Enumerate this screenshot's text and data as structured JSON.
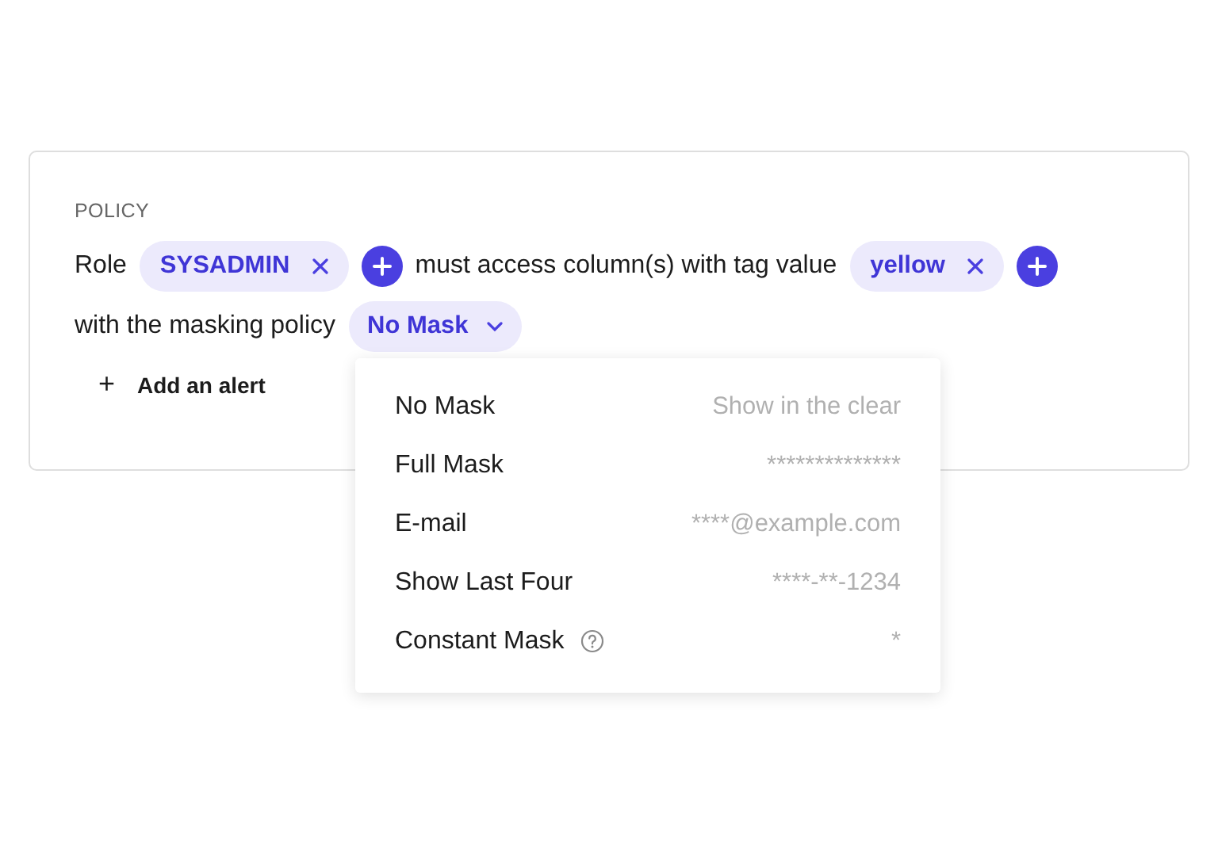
{
  "policy": {
    "heading": "POLICY",
    "lines": [
      [
        {
          "kind": "text",
          "text": "Role"
        },
        {
          "kind": "chip",
          "text": "SYSADMIN"
        },
        {
          "kind": "add"
        },
        {
          "kind": "text",
          "text": "must access column(s) with tag value"
        },
        {
          "kind": "chip",
          "text": "yellow"
        },
        {
          "kind": "add"
        }
      ],
      [
        {
          "kind": "text",
          "text": "with the masking policy"
        },
        {
          "kind": "select",
          "text": "No Mask",
          "expanded": true
        }
      ]
    ],
    "add_alert": {
      "icon": "+",
      "label": "Add an alert"
    }
  },
  "menu": {
    "options": [
      {
        "label": "No Mask",
        "example": "Show in the clear",
        "help": false
      },
      {
        "label": "Full Mask",
        "example": "**************",
        "help": false
      },
      {
        "label": "E-mail",
        "example": "****@example.com",
        "help": false
      },
      {
        "label": "Show Last Four",
        "example": "****-**-1234",
        "help": false
      },
      {
        "label": "Constant Mask",
        "example": "*",
        "help": true
      }
    ]
  }
}
